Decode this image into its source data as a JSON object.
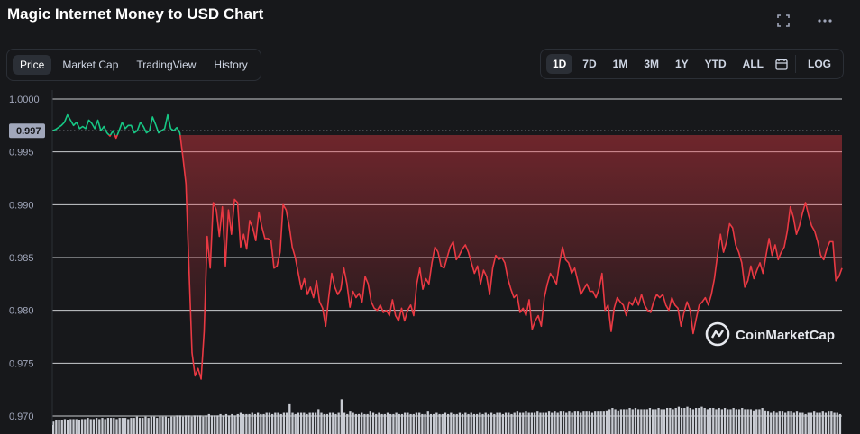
{
  "header": {
    "title": "Magic Internet Money to USD Chart",
    "fullscreen_icon": "fullscreen-icon",
    "more_icon": "more-dots-icon"
  },
  "tabs": [
    "Price",
    "Market Cap",
    "TradingView",
    "History"
  ],
  "active_tab": "Price",
  "ranges": [
    "1D",
    "7D",
    "1M",
    "3M",
    "1Y",
    "YTD",
    "ALL"
  ],
  "active_range": "1D",
  "calendar_icon": "calendar-icon",
  "log_label": "LOG",
  "watermark": "CoinMarketCap",
  "colors": {
    "up": "#16c784",
    "down": "#ea3943",
    "grid": "#e9ecef",
    "bg": "#17181b"
  },
  "chart_data": {
    "type": "line",
    "title": "Magic Internet Money to USD Chart",
    "ylabel": "",
    "ylim": [
      0.97,
      1.0
    ],
    "yticks": [
      "1.0000",
      "0.995",
      "0.990",
      "0.985",
      "0.980",
      "0.975",
      "0.970"
    ],
    "reference_price": 0.997,
    "reference_label": "0.997",
    "series": [
      {
        "values": [
          0.997,
          0.9971,
          0.9973,
          0.9975,
          0.9978,
          0.9985,
          0.998,
          0.9975,
          0.9978,
          0.9972,
          0.9974,
          0.9972,
          0.998,
          0.9977,
          0.9972,
          0.998,
          0.997,
          0.9974,
          0.9968,
          0.9965,
          0.997,
          0.9963,
          0.997,
          0.9978,
          0.9972,
          0.9975,
          0.9975,
          0.9968,
          0.997,
          0.9978,
          0.9974,
          0.9968,
          0.997,
          0.9983,
          0.9976,
          0.9968,
          0.997,
          0.9972,
          0.9985,
          0.9972,
          0.997,
          0.9973,
          0.9968,
          0.9945,
          0.992,
          0.984,
          0.976,
          0.9738,
          0.9745,
          0.9735,
          0.978,
          0.987,
          0.984,
          0.9902,
          0.9895,
          0.987,
          0.9898,
          0.9842,
          0.9895,
          0.9872,
          0.9905,
          0.9902,
          0.986,
          0.9872,
          0.9858,
          0.9885,
          0.9878,
          0.9866,
          0.9893,
          0.9879,
          0.9868,
          0.9868,
          0.9866,
          0.984,
          0.9842,
          0.9855,
          0.99,
          0.9895,
          0.988,
          0.986,
          0.985,
          0.9835,
          0.982,
          0.983,
          0.9815,
          0.9822,
          0.9812,
          0.9828,
          0.9808,
          0.9802,
          0.9785,
          0.9812,
          0.9835,
          0.9822,
          0.9815,
          0.982,
          0.984,
          0.9825,
          0.9803,
          0.9818,
          0.9812,
          0.9816,
          0.9808,
          0.9832,
          0.9825,
          0.9808,
          0.9802,
          0.98,
          0.9805,
          0.9798,
          0.98,
          0.9795,
          0.981,
          0.9795,
          0.979,
          0.9802,
          0.979,
          0.98,
          0.9805,
          0.9795,
          0.9825,
          0.984,
          0.982,
          0.983,
          0.9825,
          0.9845,
          0.986,
          0.9855,
          0.9842,
          0.984,
          0.985,
          0.986,
          0.9865,
          0.9848,
          0.9852,
          0.9858,
          0.9862,
          0.9855,
          0.9845,
          0.9835,
          0.9842,
          0.9825,
          0.9838,
          0.9832,
          0.9815,
          0.984,
          0.9852,
          0.9848,
          0.985,
          0.9845,
          0.983,
          0.982,
          0.9812,
          0.9815,
          0.9798,
          0.9802,
          0.9795,
          0.981,
          0.9782,
          0.979,
          0.9795,
          0.9785,
          0.9812,
          0.9825,
          0.9835,
          0.983,
          0.9825,
          0.9845,
          0.986,
          0.9848,
          0.9845,
          0.9835,
          0.984,
          0.9828,
          0.9815,
          0.982,
          0.9825,
          0.9818,
          0.9818,
          0.9812,
          0.982,
          0.9835,
          0.98,
          0.9805,
          0.978,
          0.9802,
          0.9812,
          0.9808,
          0.9805,
          0.9795,
          0.9808,
          0.9805,
          0.9812,
          0.9805,
          0.9815,
          0.9805,
          0.98,
          0.9798,
          0.9808,
          0.9815,
          0.9812,
          0.9815,
          0.9805,
          0.98,
          0.9812,
          0.9805,
          0.9802,
          0.9785,
          0.9798,
          0.9808,
          0.98,
          0.9778,
          0.9792,
          0.9805,
          0.9808,
          0.9812,
          0.9805,
          0.9815,
          0.983,
          0.9852,
          0.9872,
          0.9855,
          0.9865,
          0.9882,
          0.9878,
          0.9862,
          0.9855,
          0.9845,
          0.9822,
          0.9828,
          0.9842,
          0.983,
          0.9838,
          0.9845,
          0.9835,
          0.9852,
          0.9868,
          0.9852,
          0.9862,
          0.9848,
          0.9855,
          0.986,
          0.9875,
          0.9898,
          0.9888,
          0.9872,
          0.988,
          0.9892,
          0.9902,
          0.989,
          0.988,
          0.9875,
          0.9865,
          0.9852,
          0.9848,
          0.9858,
          0.9865,
          0.9865,
          0.9828,
          0.9832,
          0.984
        ]
      }
    ],
    "volume": [
      0.1,
      0.11,
      0.11,
      0.11,
      0.12,
      0.11,
      0.12,
      0.12,
      0.12,
      0.11,
      0.12,
      0.12,
      0.13,
      0.12,
      0.12,
      0.13,
      0.12,
      0.13,
      0.12,
      0.13,
      0.13,
      0.13,
      0.12,
      0.13,
      0.13,
      0.13,
      0.12,
      0.13,
      0.13,
      0.14,
      0.13,
      0.13,
      0.14,
      0.13,
      0.14,
      0.14,
      0.13,
      0.14,
      0.14,
      0.14,
      0.13,
      0.14,
      0.14,
      0.15,
      0.15,
      0.14,
      0.15,
      0.15,
      0.14,
      0.15,
      0.15,
      0.15,
      0.14,
      0.15,
      0.16,
      0.15,
      0.15,
      0.15,
      0.16,
      0.15,
      0.16,
      0.15,
      0.16,
      0.15,
      0.16,
      0.17,
      0.16,
      0.16,
      0.16,
      0.17,
      0.16,
      0.17,
      0.16,
      0.16,
      0.17,
      0.17,
      0.16,
      0.17,
      0.17,
      0.16,
      0.17,
      0.17,
      0.24,
      0.17,
      0.16,
      0.17,
      0.17,
      0.17,
      0.16,
      0.17,
      0.17,
      0.17,
      0.2,
      0.17,
      0.16,
      0.16,
      0.17,
      0.17,
      0.16,
      0.17,
      0.28,
      0.17,
      0.16,
      0.18,
      0.17,
      0.16,
      0.16,
      0.17,
      0.16,
      0.16,
      0.18,
      0.17,
      0.16,
      0.17,
      0.16,
      0.16,
      0.17,
      0.16,
      0.16,
      0.17,
      0.16,
      0.16,
      0.17,
      0.17,
      0.16,
      0.16,
      0.17,
      0.17,
      0.16,
      0.16,
      0.18,
      0.16,
      0.16,
      0.17,
      0.16,
      0.16,
      0.17,
      0.16,
      0.17,
      0.16,
      0.16,
      0.17,
      0.16,
      0.17,
      0.16,
      0.17,
      0.16,
      0.16,
      0.17,
      0.16,
      0.17,
      0.16,
      0.17,
      0.16,
      0.17,
      0.17,
      0.16,
      0.17,
      0.17,
      0.16,
      0.17,
      0.18,
      0.17,
      0.17,
      0.18,
      0.17,
      0.17,
      0.17,
      0.18,
      0.17,
      0.17,
      0.17,
      0.18,
      0.17,
      0.18,
      0.17,
      0.18,
      0.18,
      0.17,
      0.18,
      0.17,
      0.18,
      0.18,
      0.17,
      0.18,
      0.18,
      0.18,
      0.17,
      0.18,
      0.18,
      0.18,
      0.18,
      0.19,
      0.2,
      0.21,
      0.2,
      0.19,
      0.2,
      0.2,
      0.2,
      0.21,
      0.2,
      0.21,
      0.2,
      0.2,
      0.2,
      0.2,
      0.21,
      0.2,
      0.2,
      0.21,
      0.2,
      0.2,
      0.21,
      0.21,
      0.2,
      0.21,
      0.22,
      0.21,
      0.21,
      0.22,
      0.21,
      0.2,
      0.21,
      0.21,
      0.22,
      0.21,
      0.2,
      0.21,
      0.21,
      0.2,
      0.21,
      0.2,
      0.21,
      0.2,
      0.2,
      0.21,
      0.2,
      0.2,
      0.21,
      0.2,
      0.2,
      0.2,
      0.19,
      0.2,
      0.2,
      0.21,
      0.19,
      0.18,
      0.17,
      0.18,
      0.17,
      0.18,
      0.18,
      0.17,
      0.18,
      0.18,
      0.17,
      0.18,
      0.17,
      0.17,
      0.16,
      0.17,
      0.17,
      0.18,
      0.17,
      0.17,
      0.18,
      0.17,
      0.18,
      0.18,
      0.17,
      0.17,
      0.16
    ]
  }
}
